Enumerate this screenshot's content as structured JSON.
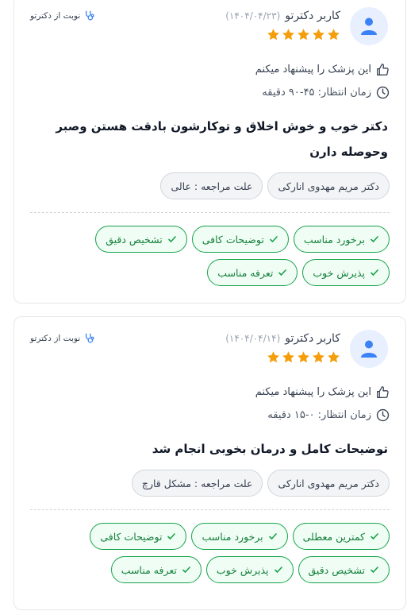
{
  "colors": {
    "star": "#f59e0b",
    "accent_green": "#16a34a",
    "avatar_bg": "#e8efff",
    "avatar_icon": "#3b82f6"
  },
  "icons": {
    "avatar": "user-icon",
    "recommend": "thumbs-up-icon",
    "wait": "clock-icon",
    "source": "stethoscope-icon",
    "tag": "check-icon",
    "rating": "star-icon"
  },
  "reviews": [
    {
      "user": "کاربر دکترتو",
      "date": "(۱۴۰۴/۰۴/۲۳)",
      "rating": 5,
      "source": "نوبت از دکترتو",
      "recommend": "این پزشک را پیشنهاد میکنم",
      "wait": "زمان انتظار: ۴۵-۹۰ دقیقه",
      "comment": "دکتر خوب و خوش اخلاق و توکارشون بادقت هستن وصبر وحوصله دارن",
      "doctor": "دکتر مریم مهدوی انارکی",
      "reason": "علت مراجعه : عالی",
      "tags": [
        "برخورد مناسب",
        "توضیحات کافی",
        "تشخیص دقیق",
        "پذیرش خوب",
        "تعرفه مناسب"
      ]
    },
    {
      "user": "کاربر دکترتو",
      "date": "(۱۴۰۴/۰۴/۱۴)",
      "rating": 5,
      "source": "نوبت از دکترتو",
      "recommend": "این پزشک را پیشنهاد میکنم",
      "wait": "زمان انتظار: ۰-۱۵ دقیقه",
      "comment": "توضیحات کامل و درمان بخوبی انجام شد",
      "doctor": "دکتر مریم مهدوی انارکی",
      "reason": "علت مراجعه : مشکل قارچ",
      "tags": [
        "کمترین معطلی",
        "برخورد مناسب",
        "توضیحات کافی",
        "تشخیص دقیق",
        "پذیرش خوب",
        "تعرفه مناسب"
      ]
    }
  ]
}
